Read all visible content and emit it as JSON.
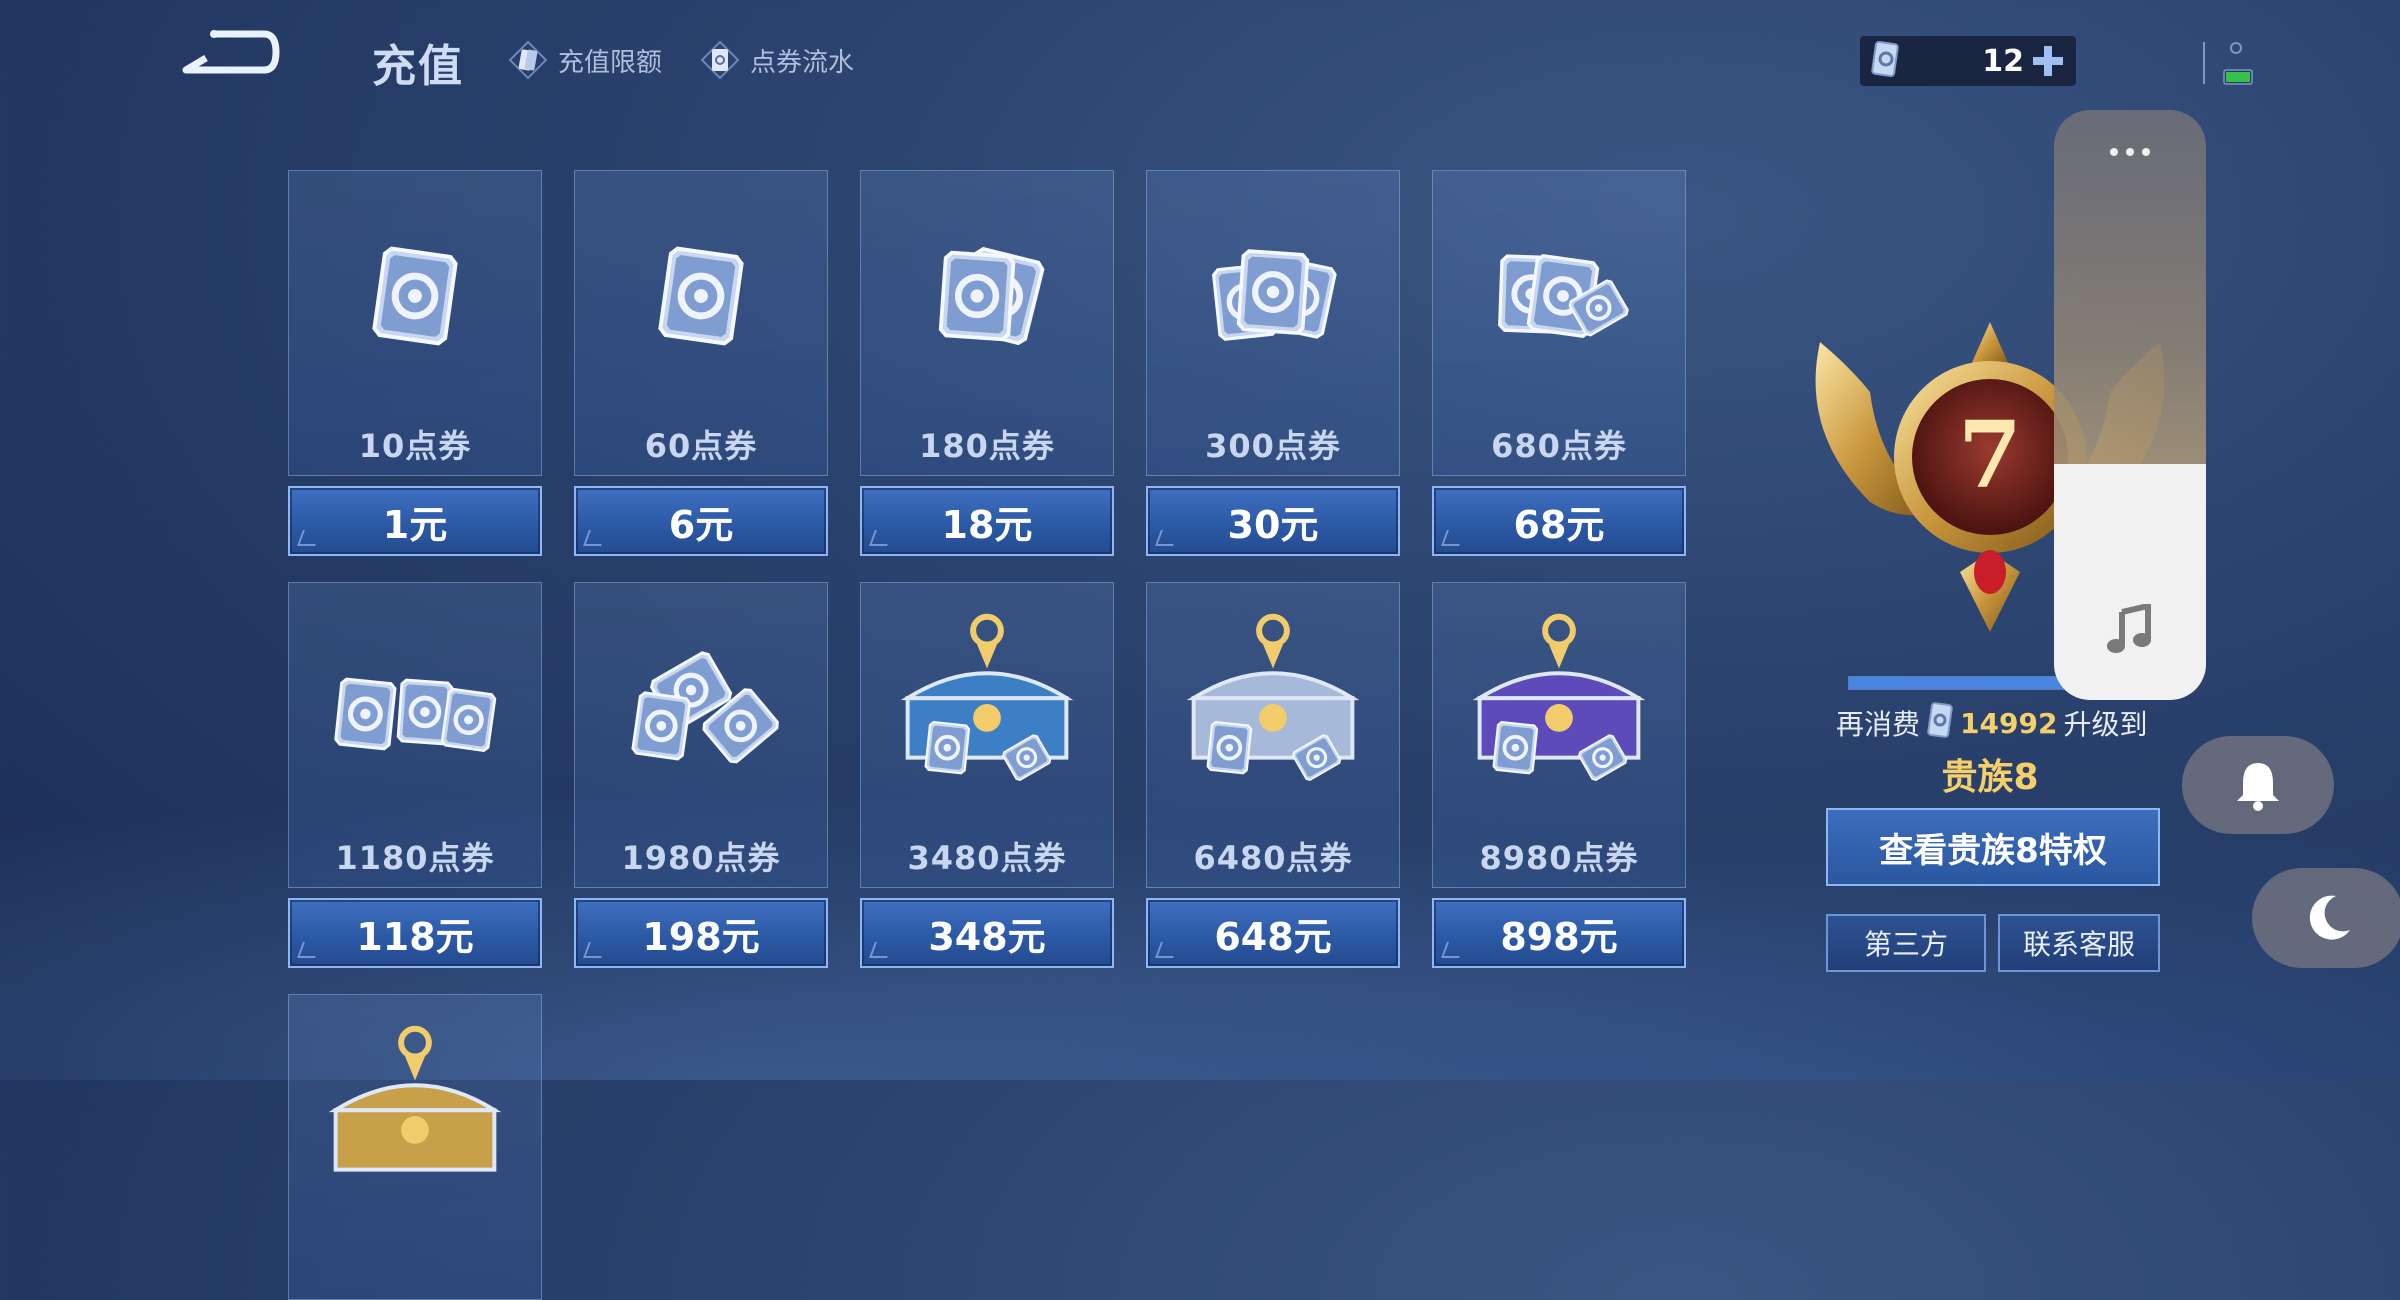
{
  "header": {
    "title": "充值",
    "nav_limit": "充值限额",
    "nav_flow": "点券流水",
    "currency_amount": "12"
  },
  "products": [
    {
      "amount_label": "10点券",
      "price_label": "1元",
      "art": "single-card-icon"
    },
    {
      "amount_label": "60点券",
      "price_label": "6元",
      "art": "single-card-icon"
    },
    {
      "amount_label": "180点券",
      "price_label": "18元",
      "art": "two-cards-icon"
    },
    {
      "amount_label": "300点券",
      "price_label": "30元",
      "art": "three-cards-icon"
    },
    {
      "amount_label": "680点券",
      "price_label": "68元",
      "art": "card-fan-icon"
    },
    {
      "amount_label": "1180点券",
      "price_label": "118元",
      "art": "card-pile-icon"
    },
    {
      "amount_label": "1980点券",
      "price_label": "198元",
      "art": "card-stack-icon"
    },
    {
      "amount_label": "3480点券",
      "price_label": "348元",
      "art": "blue-chest-icon"
    },
    {
      "amount_label": "6480点券",
      "price_label": "648元",
      "art": "silver-chest-icon"
    },
    {
      "amount_label": "8980点券",
      "price_label": "898元",
      "art": "purple-chest-icon"
    },
    {
      "amount_label": "",
      "price_label": "",
      "art": "gold-chest-icon"
    }
  ],
  "noble": {
    "current_level": "7",
    "progress_fraction": 0.75,
    "consume_prefix": "再消费",
    "consume_amount": "14992",
    "consume_suffix": "升级到",
    "next_level_label": "贵族8",
    "view_button": "查看贵族8特权"
  },
  "actions": {
    "third_party": "第三方",
    "customer_service": "联系客服"
  },
  "system_overlay": {
    "volume_level": 0.4
  },
  "colors": {
    "background": "#2c4470",
    "button_blue": "#2c5aa6",
    "gold_text": "#f4cf6a",
    "border_light": "#8db6f2"
  }
}
